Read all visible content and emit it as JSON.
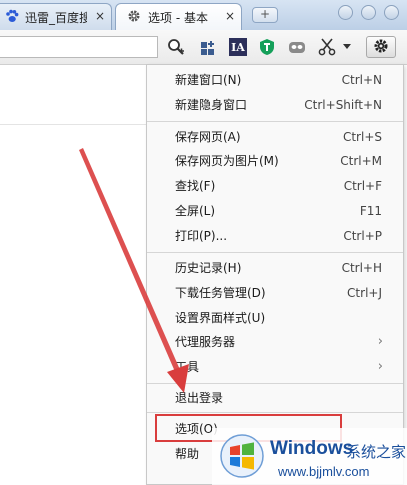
{
  "tabs": [
    {
      "title": "迅雷_百度搜",
      "close": "×",
      "icon": "baidu-paw-icon"
    },
    {
      "title": "选项 - 基本",
      "close": "×",
      "icon": "gear-icon"
    }
  ],
  "new_tab_symbol": "+",
  "toolbar": {
    "ia_label": "IA"
  },
  "menu": {
    "items": [
      {
        "label": "新建窗口(N)",
        "shortcut": "Ctrl+N"
      },
      {
        "label": "新建隐身窗口",
        "shortcut": "Ctrl+Shift+N"
      },
      {
        "label": "保存网页(A)",
        "shortcut": "Ctrl+S"
      },
      {
        "label": "保存网页为图片(M)",
        "shortcut": "Ctrl+M"
      },
      {
        "label": "查找(F)",
        "shortcut": "Ctrl+F"
      },
      {
        "label": "全屏(L)",
        "shortcut": "F11"
      },
      {
        "label": "打印(P)...",
        "shortcut": "Ctrl+P"
      },
      {
        "label": "历史记录(H)",
        "shortcut": "Ctrl+H"
      },
      {
        "label": "下载任务管理(D)",
        "shortcut": "Ctrl+J"
      },
      {
        "label": "设置界面样式(U)",
        "shortcut": ""
      },
      {
        "label": "代理服务器",
        "shortcut": ""
      },
      {
        "label": "工具",
        "shortcut": ""
      },
      {
        "label": "退出登录",
        "shortcut": ""
      },
      {
        "label": "选项(O)",
        "shortcut": ""
      },
      {
        "label": "帮助",
        "shortcut": ""
      }
    ],
    "submenu_arrow": "›"
  },
  "annotation": {
    "color": "#d93d3d"
  },
  "watermark": {
    "brand": "Windows",
    "cn": "系统之家",
    "url": "www.bjjmlv.com"
  }
}
